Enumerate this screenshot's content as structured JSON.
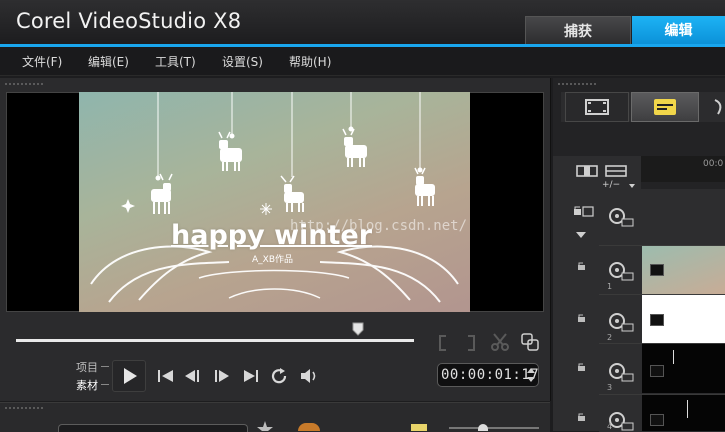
{
  "app": {
    "title_main": "Corel  VideoStudio",
    "title_version": "X8"
  },
  "tabs": [
    {
      "label": "捕获"
    },
    {
      "label": "编辑"
    }
  ],
  "menu": [
    {
      "label": "文件(F)"
    },
    {
      "label": "编辑(E)"
    },
    {
      "label": "工具(T)"
    },
    {
      "label": "设置(S)"
    },
    {
      "label": "帮助(H)"
    }
  ],
  "preview": {
    "frame_title": "happy winter",
    "frame_credit": "A_XB作品",
    "watermark": "http://blog.csdn.net/"
  },
  "transport": {
    "mode_project": "项目",
    "mode_clip": "素材",
    "timecode": "00:00:01:17",
    "scrub_position": 0.86
  },
  "timeline": {
    "ruler_label": "00:0",
    "track_add_label": "+/−",
    "rows": [
      {
        "num": "1"
      },
      {
        "num": "2"
      },
      {
        "num": "3"
      },
      {
        "num": "4"
      }
    ]
  },
  "colors": {
    "accent": "#19a6ee",
    "tab_active": "#0a8fd6"
  }
}
